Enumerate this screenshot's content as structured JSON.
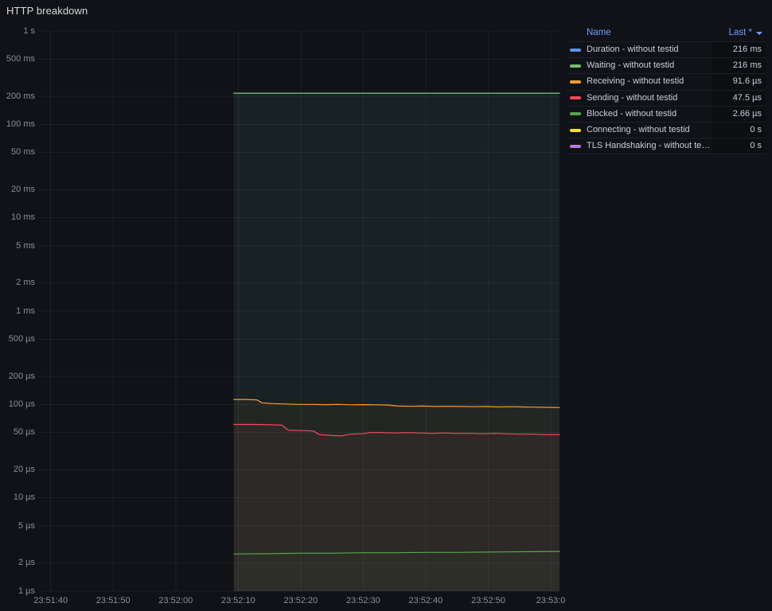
{
  "panel": {
    "title": "HTTP breakdown"
  },
  "legend": {
    "name_header": "Name",
    "value_header": "Last *",
    "rows": [
      {
        "id": "duration",
        "label": "Duration - without testid",
        "value": "216 ms",
        "color": "#5794F2"
      },
      {
        "id": "waiting",
        "label": "Waiting - without testid",
        "value": "216 ms",
        "color": "#73BF69"
      },
      {
        "id": "receiving",
        "label": "Receiving - without testid",
        "value": "91.6 µs",
        "color": "#FF9830"
      },
      {
        "id": "sending",
        "label": "Sending - without testid",
        "value": "47.5 µs",
        "color": "#F2495C"
      },
      {
        "id": "blocked",
        "label": "Blocked - without testid",
        "value": "2.66 µs",
        "color": "#56A64B"
      },
      {
        "id": "connecting",
        "label": "Connecting - without testid",
        "value": "0 s",
        "color": "#FADE2A"
      },
      {
        "id": "tls",
        "label": "TLS Handshaking - without testid",
        "value": "0 s",
        "color": "#B877D9"
      }
    ]
  },
  "chart_data": {
    "type": "line",
    "title": "HTTP breakdown",
    "y_scale": "log10",
    "y_unit": "seconds",
    "ylim": [
      1e-06,
      1
    ],
    "grid": true,
    "legend_position": "right-table",
    "y_ticks": [
      "1 s",
      "500 ms",
      "200 ms",
      "100 ms",
      "50 ms",
      "20 ms",
      "10 ms",
      "5 ms",
      "2 ms",
      "1 ms",
      "500 µs",
      "200 µs",
      "100 µs",
      "50 µs",
      "20 µs",
      "10 µs",
      "5 µs",
      "2 µs",
      "1 µs"
    ],
    "y_tick_values_s": [
      1,
      0.5,
      0.2,
      0.1,
      0.05,
      0.02,
      0.01,
      0.005,
      0.002,
      0.001,
      0.0005,
      0.0002,
      0.0001,
      5e-05,
      2e-05,
      1e-05,
      5e-06,
      2e-06,
      1e-06
    ],
    "x_ticks": [
      "23:51:40",
      "23:51:50",
      "23:52:00",
      "23:52:10",
      "23:52:20",
      "23:52:30",
      "23:52:40",
      "23:52:50",
      "23:53:0"
    ],
    "x_tick_seconds": [
      0,
      10,
      20,
      30,
      40,
      50,
      60,
      70,
      80
    ],
    "x_range_seconds": [
      -2,
      81.4
    ],
    "fill_opacity": 0.05,
    "series": [
      {
        "id": "duration",
        "name": "Duration - without testid",
        "color": "#5794F2",
        "last": "216 ms",
        "points": [
          [
            29.3,
            0.216
          ],
          [
            81.4,
            0.216
          ]
        ]
      },
      {
        "id": "waiting",
        "name": "Waiting - without testid",
        "color": "#73BF69",
        "last": "216 ms",
        "points": [
          [
            29.3,
            0.216
          ],
          [
            81.4,
            0.216
          ]
        ]
      },
      {
        "id": "receiving",
        "name": "Receiving - without testid",
        "color": "#FF9830",
        "last": "91.6 µs",
        "points": [
          [
            29.3,
            0.000113
          ],
          [
            31,
            0.000113
          ],
          [
            33,
            0.000112
          ],
          [
            33.8,
            0.000104
          ],
          [
            35.5,
            0.000102
          ],
          [
            37.5,
            0.000101
          ],
          [
            39.5,
            0.0001
          ],
          [
            42,
            0.0001
          ],
          [
            44,
            9.95e-05
          ],
          [
            46,
            0.0001
          ],
          [
            48,
            9.9e-05
          ],
          [
            50,
            9.95e-05
          ],
          [
            52,
            9.9e-05
          ],
          [
            54,
            9.85e-05
          ],
          [
            55.5,
            9.6e-05
          ],
          [
            57.5,
            9.55e-05
          ],
          [
            59.5,
            9.6e-05
          ],
          [
            61.5,
            9.5e-05
          ],
          [
            63.5,
            9.55e-05
          ],
          [
            65.5,
            9.5e-05
          ],
          [
            67.5,
            9.45e-05
          ],
          [
            69.5,
            9.5e-05
          ],
          [
            71.5,
            9.4e-05
          ],
          [
            73.5,
            9.45e-05
          ],
          [
            75.5,
            9.4e-05
          ],
          [
            77.5,
            9.35e-05
          ],
          [
            79.5,
            9.3e-05
          ],
          [
            81.4,
            9.25e-05
          ]
        ]
      },
      {
        "id": "sending",
        "name": "Sending - without testid",
        "color": "#F2495C",
        "last": "47.5 µs",
        "points": [
          [
            29.3,
            6.1e-05
          ],
          [
            33,
            6.1e-05
          ],
          [
            35,
            6.05e-05
          ],
          [
            37,
            6e-05
          ],
          [
            38,
            5.3e-05
          ],
          [
            40,
            5.25e-05
          ],
          [
            42,
            5.2e-05
          ],
          [
            43,
            4.75e-05
          ],
          [
            45,
            4.65e-05
          ],
          [
            46.5,
            4.6e-05
          ],
          [
            48,
            4.8e-05
          ],
          [
            50,
            4.85e-05
          ],
          [
            51,
            5e-05
          ],
          [
            53,
            5e-05
          ],
          [
            55,
            4.95e-05
          ],
          [
            57,
            5e-05
          ],
          [
            59,
            4.95e-05
          ],
          [
            61,
            4.9e-05
          ],
          [
            63,
            4.95e-05
          ],
          [
            65,
            4.9e-05
          ],
          [
            67,
            4.9e-05
          ],
          [
            69,
            4.85e-05
          ],
          [
            71,
            4.9e-05
          ],
          [
            73,
            4.85e-05
          ],
          [
            75,
            4.8e-05
          ],
          [
            77,
            4.8e-05
          ],
          [
            79,
            4.75e-05
          ],
          [
            81.4,
            4.75e-05
          ]
        ]
      },
      {
        "id": "blocked",
        "name": "Blocked - without testid",
        "color": "#56A64B",
        "last": "2.66 µs",
        "points": [
          [
            29.3,
            2.5e-06
          ],
          [
            35,
            2.52e-06
          ],
          [
            40,
            2.55e-06
          ],
          [
            45,
            2.55e-06
          ],
          [
            50,
            2.58e-06
          ],
          [
            55,
            2.58e-06
          ],
          [
            60,
            2.6e-06
          ],
          [
            65,
            2.6e-06
          ],
          [
            70,
            2.62e-06
          ],
          [
            75,
            2.64e-06
          ],
          [
            81.4,
            2.66e-06
          ]
        ]
      },
      {
        "id": "connecting",
        "name": "Connecting - without testid",
        "color": "#FADE2A",
        "last": "0 s",
        "points": []
      },
      {
        "id": "tls",
        "name": "TLS Handshaking - without testid",
        "color": "#B877D9",
        "last": "0 s",
        "points": []
      }
    ]
  }
}
